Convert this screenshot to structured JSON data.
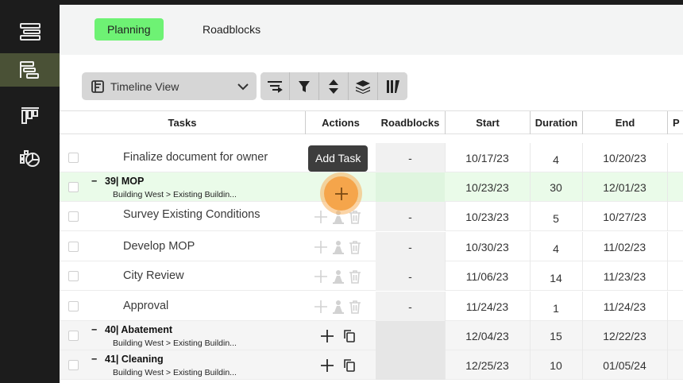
{
  "tabs": [
    {
      "label": "Planning",
      "active": true
    },
    {
      "label": "Roadblocks",
      "active": false
    }
  ],
  "toolbar": {
    "view_label": "Timeline View",
    "tools": [
      "grouping-icon",
      "filter-icon",
      "sort-icon",
      "layers-icon",
      "columns-icon"
    ]
  },
  "columns": {
    "tasks": "Tasks",
    "actions": "Actions",
    "roadblocks": "Roadblocks",
    "start": "Start",
    "duration": "Duration",
    "end": "End",
    "extra": "P"
  },
  "tooltip": "Add Task",
  "rows": [
    {
      "type": "child",
      "name": "Finalize document for owner",
      "roadblocks": "-",
      "start": "10/17/23",
      "duration": "4",
      "end": "10/20/23"
    },
    {
      "type": "parent",
      "dash": "−",
      "name": "39| MOP",
      "path": "Building West > Existing Buildin...",
      "roadblocks": "",
      "start": "10/23/23",
      "duration": "30",
      "end": "12/01/23"
    },
    {
      "type": "child",
      "name": "Survey Existing Conditions",
      "roadblocks": "-",
      "start": "10/23/23",
      "duration": "5",
      "end": "10/27/23"
    },
    {
      "type": "child",
      "name": "Develop MOP",
      "roadblocks": "-",
      "start": "10/30/23",
      "duration": "4",
      "end": "11/02/23"
    },
    {
      "type": "child",
      "name": "City Review",
      "roadblocks": "-",
      "start": "11/06/23",
      "duration": "14",
      "end": "11/23/23"
    },
    {
      "type": "child",
      "name": "Approval",
      "roadblocks": "-",
      "start": "11/24/23",
      "duration": "1",
      "end": "11/24/23"
    },
    {
      "type": "parent",
      "dash": "−",
      "name": "40| Abatement",
      "path": "Building West > Existing Buildin...",
      "roadblocks": "",
      "start": "12/04/23",
      "duration": "15",
      "end": "12/22/23"
    },
    {
      "type": "parent",
      "dash": "−",
      "name": "41| Cleaning",
      "path": "Building West > Existing Buildin...",
      "roadblocks": "",
      "start": "12/25/23",
      "duration": "10",
      "end": "01/05/24"
    }
  ],
  "colors": {
    "sidebar": "#1c1c1c",
    "sidebar_active": "#4a5136",
    "tab_active": "#6ef274",
    "highlight_row": "#eafbe9",
    "fab": "#f5a54b"
  }
}
